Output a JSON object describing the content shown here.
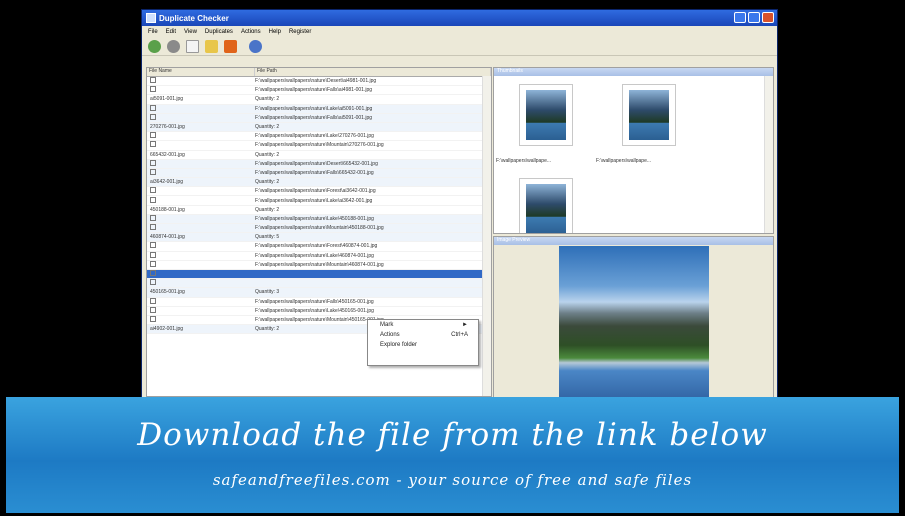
{
  "window": {
    "title": "Duplicate Checker"
  },
  "menu": [
    "File",
    "Edit",
    "View",
    "Duplicates",
    "Actions",
    "Help",
    "Register"
  ],
  "toolbar_icons": [
    "scan-icon",
    "stop-icon",
    "new-icon",
    "open-icon",
    "delete-icon",
    "help-icon"
  ],
  "list": {
    "columns": [
      "File Name",
      "File Path"
    ],
    "rows": [
      {
        "name": "",
        "path": "F:\\wallpapers\\wallpapers\\nature\\Desert\\ai4981-001.jpg"
      },
      {
        "name": "",
        "path": "F:\\wallpapers\\wallpapers\\nature\\Falls\\ai4981-001.jpg"
      },
      {
        "name": "ai5091-001.jpg",
        "path": "Quantity: 2"
      },
      {
        "name": "",
        "path": "F:\\wallpapers\\wallpapers\\nature\\Lake\\ai5091-001.jpg"
      },
      {
        "name": "",
        "path": "F:\\wallpapers\\wallpapers\\nature\\Falls\\ai5091-001.jpg"
      },
      {
        "name": "270276-001.jpg",
        "path": "Quantity: 2"
      },
      {
        "name": "",
        "path": "F:\\wallpapers\\wallpapers\\nature\\Lake\\270276-001.jpg"
      },
      {
        "name": "",
        "path": "F:\\wallpapers\\wallpapers\\nature\\Mountain\\270276-001.jpg"
      },
      {
        "name": "665432-001.jpg",
        "path": "Quantity: 2"
      },
      {
        "name": "",
        "path": "F:\\wallpapers\\wallpapers\\nature\\Desert\\665432-001.jpg"
      },
      {
        "name": "",
        "path": "F:\\wallpapers\\wallpapers\\nature\\Falls\\665432-001.jpg"
      },
      {
        "name": "ai3642-001.jpg",
        "path": "Quantity: 2"
      },
      {
        "name": "",
        "path": "F:\\wallpapers\\wallpapers\\nature\\Forest\\ai3642-001.jpg"
      },
      {
        "name": "",
        "path": "F:\\wallpapers\\wallpapers\\nature\\Lake\\ai3642-001.jpg"
      },
      {
        "name": "450188-001.jpg",
        "path": "Quantity: 2"
      },
      {
        "name": "",
        "path": "F:\\wallpapers\\wallpapers\\nature\\Lake\\450188-001.jpg"
      },
      {
        "name": "",
        "path": "F:\\wallpapers\\wallpapers\\nature\\Mountain\\450188-001.jpg"
      },
      {
        "name": "460874-001.jpg",
        "path": "Quantity: 5"
      },
      {
        "name": "",
        "path": "F:\\wallpapers\\wallpapers\\nature\\Forest\\460874-001.jpg"
      },
      {
        "name": "",
        "path": "F:\\wallpapers\\wallpapers\\nature\\Lake\\460874-001.jpg"
      },
      {
        "name": "",
        "path": "F:\\wallpapers\\wallpapers\\nature\\Mountain\\460874-001.jpg"
      },
      {
        "name": "",
        "path": ""
      },
      {
        "name": "",
        "path": ""
      },
      {
        "name": "450165-001.jpg",
        "path": "Quantity: 3"
      },
      {
        "name": "",
        "path": "F:\\wallpapers\\wallpapers\\nature\\Falls\\450165-001.jpg"
      },
      {
        "name": "",
        "path": "F:\\wallpapers\\wallpapers\\nature\\Lake\\450165-001.jpg"
      },
      {
        "name": "",
        "path": "F:\\wallpapers\\wallpapers\\nature\\Mountain\\450165-001.jpg"
      },
      {
        "name": "ai4902-001.jpg",
        "path": "Quantity: 2"
      }
    ]
  },
  "context_menu": [
    {
      "label": "Mark",
      "shortcut": "►"
    },
    {
      "label": "Actions",
      "shortcut": "Ctrl+A"
    },
    {
      "label": "Explore folder",
      "shortcut": ""
    }
  ],
  "thumbnails": {
    "header": "Thumbnails",
    "captions": [
      "F:\\wallpapers\\wallpape...",
      "F:\\wallpapers\\wallpape..."
    ]
  },
  "preview": {
    "header": "Image Preview"
  },
  "banner": {
    "headline": "Download the file from the link below",
    "subline": "safeandfreefiles.com - your source of free and safe files"
  }
}
